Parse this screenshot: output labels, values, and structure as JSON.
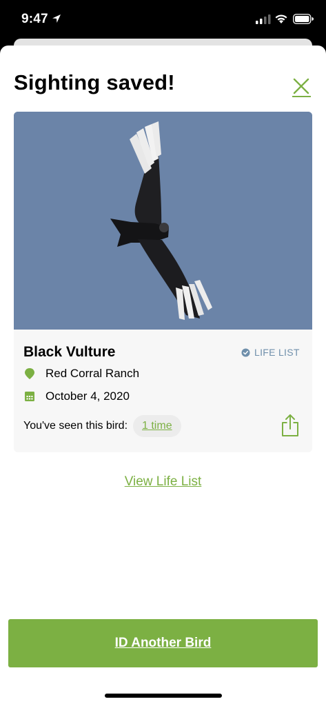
{
  "status_bar": {
    "time": "9:47"
  },
  "sheet": {
    "title": "Sighting saved!"
  },
  "sighting": {
    "bird_name": "Black Vulture",
    "badge": "LIFE LIST",
    "location": "Red Corral Ranch",
    "date": "October 4, 2020",
    "seen_label": "You've seen this bird:",
    "seen_count": "1 time"
  },
  "links": {
    "view_life_list": "View Life List"
  },
  "primary_button": {
    "label": "ID Another Bird"
  },
  "icons": {
    "close": "close-icon",
    "location": "location-pin-icon",
    "calendar": "calendar-icon",
    "check": "check-circle-icon",
    "share": "share-icon"
  },
  "colors": {
    "accent": "#7cb043",
    "badge": "#6f8fab",
    "sky": "#6b84a8"
  }
}
